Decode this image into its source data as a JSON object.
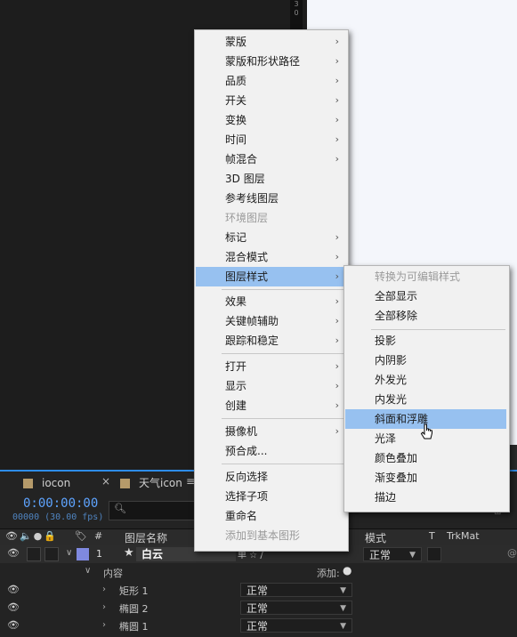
{
  "viewer": {
    "ruler_text": "3\n0"
  },
  "timeline": {
    "tabs": [
      {
        "label": "iocon",
        "close": "×"
      },
      {
        "label": "天气icon",
        "menu": "≡"
      }
    ],
    "timecode": "0:00:00:00",
    "fps": "00000 (30.00 fps)",
    "search_icon": "🔍︎",
    "header": {
      "icons": "👁🔈●🔒",
      "tag": "🏷",
      "num": "#",
      "name": "图层名称",
      "mode": "模式",
      "t": "T",
      "trkmat": "TrkMat"
    },
    "layer": {
      "number": "1",
      "star": "★",
      "name": "白云",
      "switches": "单 ☆ /",
      "mode": "正常"
    },
    "contents": {
      "label": "内容",
      "add": "添加:",
      "add_icon": "●"
    },
    "sublayers": [
      {
        "name": "矩形 1",
        "mode": "正常"
      },
      {
        "name": "椭圆 2",
        "mode": "正常"
      },
      {
        "name": "椭圆 1",
        "mode": "正常"
      }
    ]
  },
  "context_menu": {
    "items": [
      {
        "label": "蒙版",
        "arrow": "›",
        "disabled": false
      },
      {
        "label": "蒙版和形状路径",
        "arrow": "›",
        "disabled": false
      },
      {
        "label": "品质",
        "arrow": "›",
        "disabled": false
      },
      {
        "label": "开关",
        "arrow": "›",
        "disabled": false
      },
      {
        "label": "变换",
        "arrow": "›",
        "disabled": false
      },
      {
        "label": "时间",
        "arrow": "›",
        "disabled": false
      },
      {
        "label": "帧混合",
        "arrow": "›",
        "disabled": false
      },
      {
        "label": "3D 图层",
        "arrow": "",
        "disabled": false
      },
      {
        "label": "参考线图层",
        "arrow": "",
        "disabled": false
      },
      {
        "label": "环境图层",
        "arrow": "",
        "disabled": true
      },
      {
        "label": "标记",
        "arrow": "›",
        "disabled": false
      },
      {
        "label": "混合模式",
        "arrow": "›",
        "disabled": false
      },
      {
        "label": "图层样式",
        "arrow": "›",
        "disabled": false,
        "highlight": true
      },
      {
        "label": "效果",
        "arrow": "›",
        "disabled": false
      },
      {
        "label": "关键帧辅助",
        "arrow": "›",
        "disabled": false
      },
      {
        "label": "跟踪和稳定",
        "arrow": "›",
        "disabled": false
      },
      {
        "label": "打开",
        "arrow": "›",
        "disabled": false
      },
      {
        "label": "显示",
        "arrow": "›",
        "disabled": false
      },
      {
        "label": "创建",
        "arrow": "›",
        "disabled": false
      },
      {
        "label": "摄像机",
        "arrow": "›",
        "disabled": false
      },
      {
        "label": "预合成...",
        "arrow": "",
        "disabled": false
      },
      {
        "label": "反向选择",
        "arrow": "",
        "disabled": false
      },
      {
        "label": "选择子项",
        "arrow": "",
        "disabled": false
      },
      {
        "label": "重命名",
        "arrow": "",
        "disabled": false
      },
      {
        "label": "添加到基本图形",
        "arrow": "",
        "disabled": true
      }
    ]
  },
  "submenu": {
    "items": [
      {
        "label": "转换为可编辑样式",
        "disabled": true
      },
      {
        "label": "全部显示",
        "disabled": false
      },
      {
        "label": "全部移除",
        "disabled": false
      },
      {
        "label": "投影",
        "disabled": false
      },
      {
        "label": "内阴影",
        "disabled": false
      },
      {
        "label": "外发光",
        "disabled": false
      },
      {
        "label": "内发光",
        "disabled": false
      },
      {
        "label": "斜面和浮雕",
        "disabled": false,
        "highlight": true
      },
      {
        "label": "光泽",
        "disabled": false
      },
      {
        "label": "颜色叠加",
        "disabled": false
      },
      {
        "label": "渐变叠加",
        "disabled": false
      },
      {
        "label": "描边",
        "disabled": false
      }
    ]
  },
  "colors": {
    "menu_bg": "#f1f1f1",
    "menu_highlight": "#97c1f0",
    "timecode": "#5ea4ff",
    "layer_label": "#7f89e0",
    "panel_active_border": "#2d8ceb"
  }
}
